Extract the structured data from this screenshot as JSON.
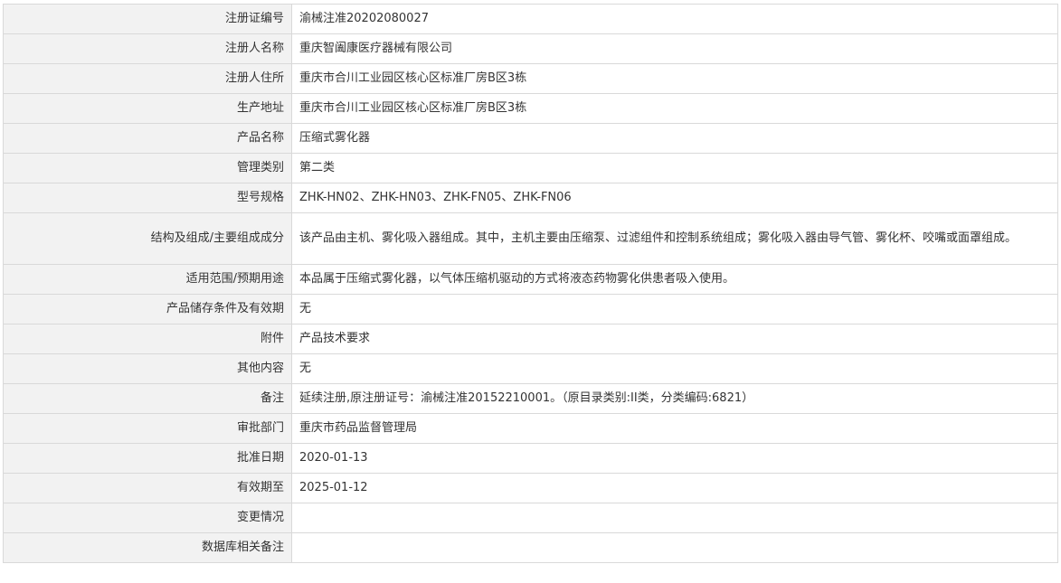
{
  "rows": [
    {
      "label": "注册证编号",
      "value": "渝械注准20202080027"
    },
    {
      "label": "注册人名称",
      "value": "重庆智阖康医疗器械有限公司"
    },
    {
      "label": "注册人住所",
      "value": "重庆市合川工业园区核心区标准厂房B区3栋"
    },
    {
      "label": "生产地址",
      "value": "重庆市合川工业园区核心区标准厂房B区3栋"
    },
    {
      "label": "产品名称",
      "value": "压缩式雾化器"
    },
    {
      "label": "管理类别",
      "value": "第二类"
    },
    {
      "label": "型号规格",
      "value": "ZHK-HN02、ZHK-HN03、ZHK-FN05、ZHK-FN06"
    },
    {
      "label": "结构及组成/主要组成成分",
      "value": "该产品由主机、雾化吸入器组成。其中，主机主要由压缩泵、过滤组件和控制系统组成；雾化吸入器由导气管、雾化杯、咬嘴或面罩组成。"
    },
    {
      "label": "适用范围/预期用途",
      "value": "本品属于压缩式雾化器，以气体压缩机驱动的方式将液态药物雾化供患者吸入使用。"
    },
    {
      "label": "产品储存条件及有效期",
      "value": "无"
    },
    {
      "label": "附件",
      "value": "产品技术要求"
    },
    {
      "label": "其他内容",
      "value": "无"
    },
    {
      "label": "备注",
      "value": "延续注册,原注册证号：渝械注准20152210001。（原目录类别:II类，分类编码:6821）"
    },
    {
      "label": "审批部门",
      "value": "重庆市药品监督管理局"
    },
    {
      "label": "批准日期",
      "value": "2020-01-13"
    },
    {
      "label": "有效期至",
      "value": "2025-01-12"
    },
    {
      "label": "变更情况",
      "value": ""
    },
    {
      "label": "数据库相关备注",
      "value": ""
    }
  ]
}
